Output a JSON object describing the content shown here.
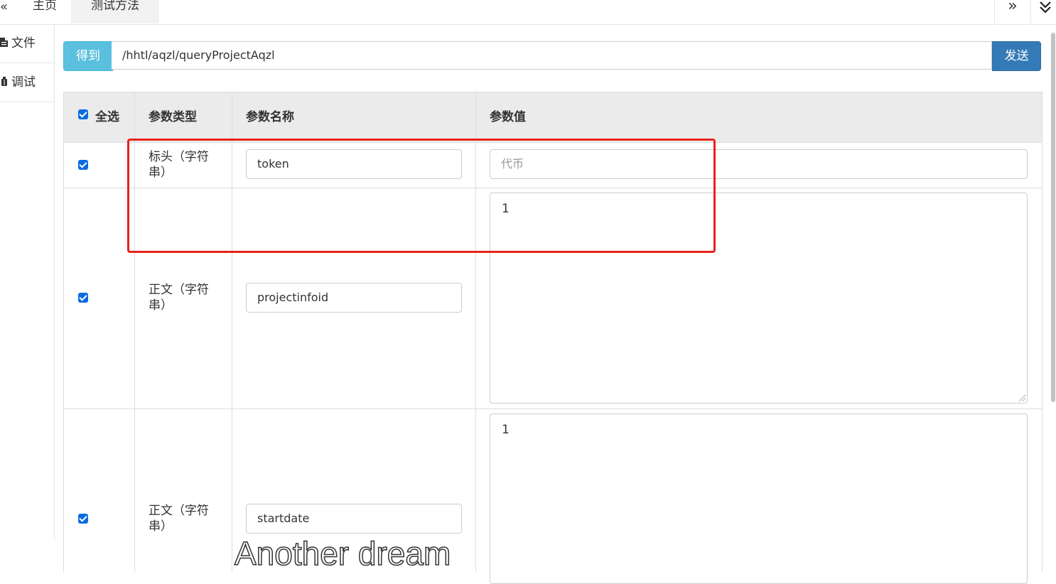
{
  "tabs": {
    "nav_left": "«",
    "items": [
      {
        "label": "主页",
        "active": false
      },
      {
        "label": "测试方法",
        "active": true
      }
    ],
    "nav_right": "»",
    "nav_down": "⌄"
  },
  "sidebar": {
    "items": [
      {
        "label": "文件",
        "icon": "file-icon"
      },
      {
        "label": "调试",
        "icon": "debug-icon"
      }
    ]
  },
  "request": {
    "method": "得到",
    "url": "/hhtl/aqzl/queryProjectAqzl",
    "send_label": "发送"
  },
  "params": {
    "headers": {
      "select_all": "全选",
      "type": "参数类型",
      "name": "参数名称",
      "value": "参数值"
    },
    "rows": [
      {
        "checked": true,
        "type": "标头（字符串）",
        "name": "token",
        "value": "",
        "value_placeholder": "代币"
      },
      {
        "checked": true,
        "type": "正文（字符串）",
        "name": "projectinfoid",
        "value": "1"
      },
      {
        "checked": true,
        "type": "正文（字符串）",
        "name": "startdate",
        "value": "1"
      }
    ]
  },
  "watermark": "Another dream",
  "colors": {
    "method_bg": "#5bc0de",
    "send_bg": "#337ab7",
    "checkbox": "#0a6cdf",
    "highlight_box": "#e8221c",
    "header_bg": "#ebebeb"
  }
}
